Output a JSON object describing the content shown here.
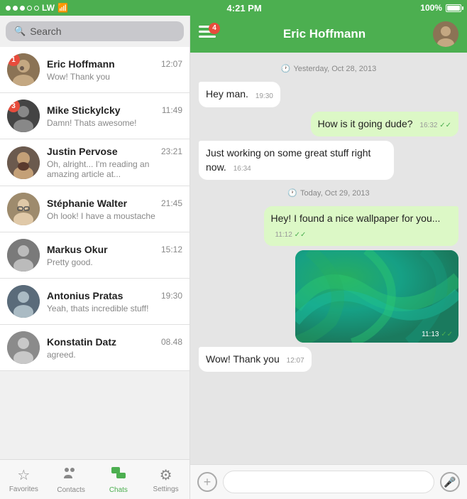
{
  "statusBar": {
    "dots": [
      "filled",
      "filled",
      "filled",
      "empty",
      "empty"
    ],
    "carrier": "LW",
    "wifi": true,
    "time": "4:21 PM",
    "battery": "100%"
  },
  "search": {
    "placeholder": "Search"
  },
  "chatList": [
    {
      "id": 1,
      "name": "Eric Hoffmann",
      "time": "12:07",
      "preview": "Wow! Thank you",
      "badge": 1,
      "avatarClass": "avatar-1"
    },
    {
      "id": 2,
      "name": "Mike Stickylcky",
      "time": "11:49",
      "preview": "Damn! Thats awesome!",
      "badge": 3,
      "avatarClass": "avatar-2"
    },
    {
      "id": 3,
      "name": "Justin Pervose",
      "time": "23:21",
      "preview": "Oh, alright... I'm reading an amazing article at...",
      "badge": 0,
      "avatarClass": "avatar-3"
    },
    {
      "id": 4,
      "name": "Stéphanie Walter",
      "time": "21:45",
      "preview": "Oh look! I have a moustache",
      "badge": 0,
      "avatarClass": "avatar-4"
    },
    {
      "id": 5,
      "name": "Markus Okur",
      "time": "15:12",
      "preview": "Pretty good.",
      "badge": 0,
      "avatarClass": "avatar-5"
    },
    {
      "id": 6,
      "name": "Antonius Pratas",
      "time": "19:30",
      "preview": "Yeah, thats incredible stuff!",
      "badge": 0,
      "avatarClass": "avatar-6"
    },
    {
      "id": 7,
      "name": "Konstatin Datz",
      "time": "08.48",
      "preview": "agreed.",
      "badge": 0,
      "avatarClass": "avatar-7"
    }
  ],
  "tabs": [
    {
      "id": "favorites",
      "label": "Favorites",
      "icon": "☆",
      "active": false
    },
    {
      "id": "contacts",
      "label": "Contacts",
      "icon": "👤",
      "active": false
    },
    {
      "id": "chats",
      "label": "Chats",
      "icon": "💬",
      "active": true
    },
    {
      "id": "settings",
      "label": "Settings",
      "icon": "⚙",
      "active": false
    }
  ],
  "activeChat": {
    "name": "Eric Hoffmann",
    "menuBadge": 4,
    "dateDividers": [
      "Yesterday, Oct 28, 2013",
      "Today, Oct 29, 2013"
    ],
    "messages": [
      {
        "id": 1,
        "type": "incoming",
        "text": "Hey man.",
        "time": "19:30",
        "checks": ""
      },
      {
        "id": 2,
        "type": "outgoing",
        "text": "How is it going dude?",
        "time": "16:32",
        "checks": "✓✓"
      },
      {
        "id": 3,
        "type": "incoming",
        "text": "Just working on some great stuff right now.",
        "time": "16:34",
        "checks": ""
      },
      {
        "id": 4,
        "type": "outgoing",
        "text": "Hey! I found a nice wallpaper for you...",
        "time": "11:12",
        "checks": "✓✓"
      },
      {
        "id": 5,
        "type": "outgoing-image",
        "time": "11:13",
        "checks": "✓✓"
      },
      {
        "id": 6,
        "type": "incoming",
        "text": "Wow! Thank you",
        "time": "12:07",
        "checks": ""
      }
    ]
  },
  "inputBar": {
    "placeholder": "",
    "addIcon": "+",
    "micIcon": "🎤"
  }
}
